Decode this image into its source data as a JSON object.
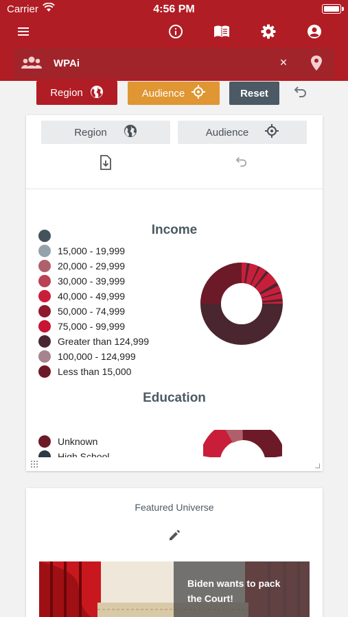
{
  "status_bar": {
    "carrier": "Carrier",
    "time": "4:56 PM"
  },
  "toolbar": {
    "icons": [
      "menu-icon",
      "info-icon",
      "book-icon",
      "gear-icon",
      "account-icon"
    ]
  },
  "search": {
    "query": "WPAi",
    "clear_label": "×"
  },
  "filters": {
    "region_label": "Region",
    "audience_label": "Audience",
    "reset_label": "Reset"
  },
  "card": {
    "region_label": "Region",
    "audience_label": "Audience",
    "income": {
      "title": "Income",
      "legend": [
        {
          "label": "",
          "color": "#44525c"
        },
        {
          "label": "15,000 - 19,999",
          "color": "#94a3ab"
        },
        {
          "label": "20,000 - 29,999",
          "color": "#b0606a"
        },
        {
          "label": "30,000 - 39,999",
          "color": "#ba4254"
        },
        {
          "label": "40,000 - 49,999",
          "color": "#c91e3a"
        },
        {
          "label": "50,000 - 74,999",
          "color": "#8f1a2c"
        },
        {
          "label": "75,000 - 99,999",
          "color": "#c81433"
        },
        {
          "label": "Greater than 124,999",
          "color": "#4a2630"
        },
        {
          "label": "100,000 - 124,999",
          "color": "#a58490"
        },
        {
          "label": "Less than 15,000",
          "color": "#6d1a28"
        }
      ]
    },
    "education": {
      "title": "Education",
      "legend": [
        {
          "label": "Unknown",
          "color": "#6d1a28"
        },
        {
          "label": "High School",
          "color": "#2e3a44"
        }
      ]
    }
  },
  "featured": {
    "title": "Featured Universe",
    "caption": "Biden wants to pack the Court!"
  },
  "colors": {
    "brand": "#b11d25",
    "audience": "#e09632",
    "reset": "#4b5a64"
  }
}
